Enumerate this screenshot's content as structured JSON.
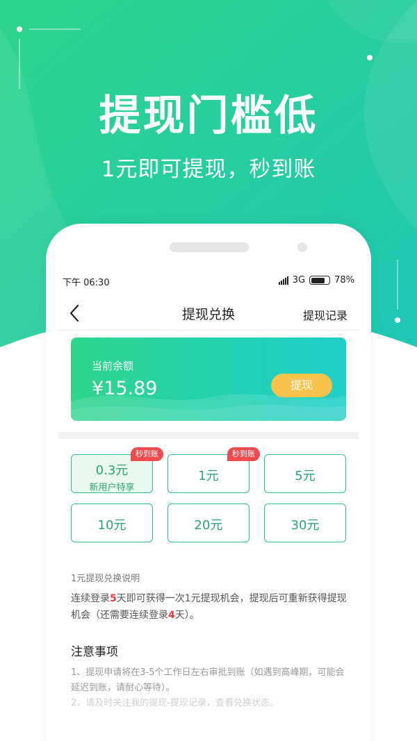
{
  "colors": {
    "hero_gradient_start": "#2fd58a",
    "hero_gradient_end": "#1ec6b5",
    "accent_green": "#2cc38b",
    "button_yellow": "#f7c34a",
    "badge_red": "#ef4b4f"
  },
  "hero": {
    "headline": "提现门槛低",
    "subline": "1元即可提现，秒到账"
  },
  "status_bar": {
    "time": "下午 06:30",
    "network": "3G",
    "battery": "78%",
    "battery_level": 0.78
  },
  "nav": {
    "back_icon": "chevron-left-icon",
    "title": "提现兑换",
    "record_link": "提现记录"
  },
  "balance": {
    "label": "当前余额",
    "value": "¥15.89",
    "button": "提现"
  },
  "options": [
    {
      "amount": "0.3元",
      "sub": "新用户特享",
      "badge": "秒到账",
      "selected": true
    },
    {
      "amount": "1元",
      "sub": "",
      "badge": "秒到账",
      "selected": false
    },
    {
      "amount": "5元",
      "sub": "",
      "badge": "",
      "selected": false
    },
    {
      "amount": "10元",
      "sub": "",
      "badge": "",
      "selected": false
    },
    {
      "amount": "20元",
      "sub": "",
      "badge": "",
      "selected": false
    },
    {
      "amount": "30元",
      "sub": "",
      "badge": "",
      "selected": false
    }
  ],
  "description": {
    "title": "1元提现兑换说明",
    "p1": "连续登录",
    "n1": "5",
    "p2": "天即可获得一次1元提现机会，提现后可重新获得提现机会（还需要连续登录",
    "n2": "4",
    "p3": "天）。"
  },
  "notice": {
    "title": "注意事项",
    "item1": "1、提现申请将在3-5个工作日左右审批到账（如遇到高峰期，可能会延迟到账，请耐心等待）。",
    "item2": "2、请及时关注我的提现-提现记录，查看兑换状态。"
  }
}
